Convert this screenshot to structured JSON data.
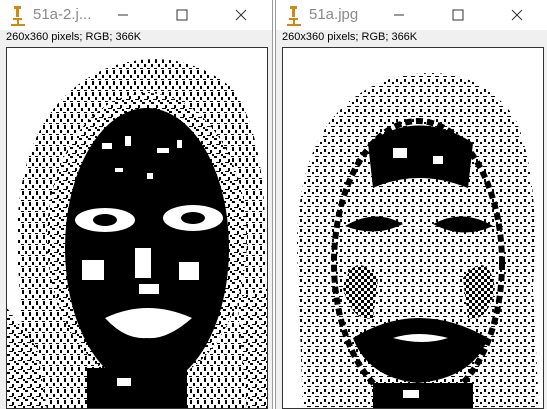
{
  "windows": [
    {
      "title": "51a-2.j...",
      "info": "260x360 pixels; RGB; 366K",
      "image_kind": "binarized-face-threshold"
    },
    {
      "title": "51a.jpg",
      "info": "260x360 pixels; RGB; 366K",
      "image_kind": "binarized-face-edges"
    }
  ],
  "colors": {
    "title_text": "#8a8a8a",
    "app_icon": "#d08a14",
    "ink": "#000000",
    "paper": "#ffffff"
  },
  "icons": [
    "imagej-microscope-icon",
    "minimize-icon",
    "maximize-icon",
    "close-icon"
  ]
}
